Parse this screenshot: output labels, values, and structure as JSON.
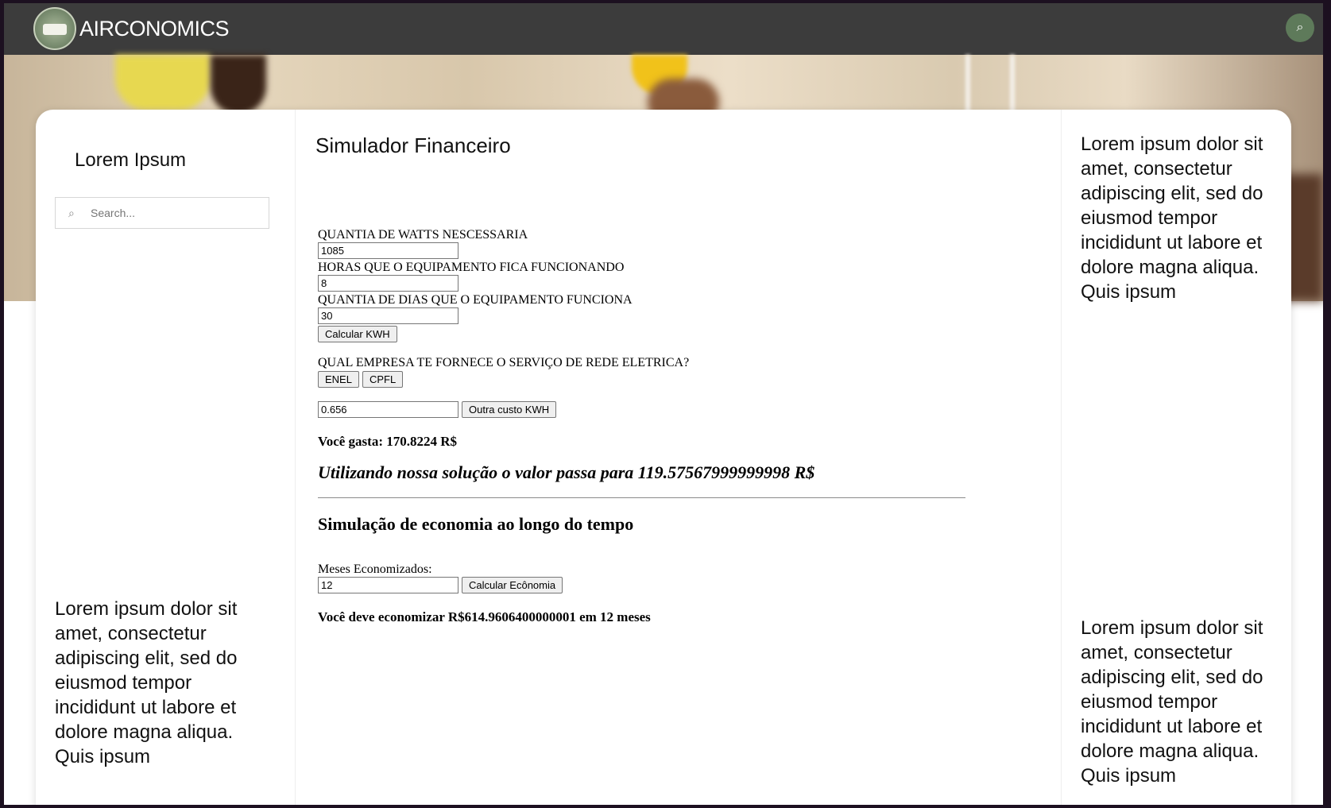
{
  "header": {
    "brand": "AIRCONOMICS",
    "search_icon_glyph": "⌕"
  },
  "left": {
    "title": "Lorem Ipsum",
    "search_placeholder": "Search...",
    "search_icon_glyph": "⌕",
    "lorem": "Lorem ipsum dolor sit amet, consectetur adipiscing elit, sed do eiusmod tempor incididunt ut labore et dolore magna aliqua. Quis ipsum"
  },
  "right": {
    "lorem_top": "Lorem ipsum dolor sit amet, consectetur adipiscing elit, sed do eiusmod tempor incididunt ut labore et dolore magna aliqua. Quis ipsum",
    "lorem_bottom": "Lorem ipsum dolor sit amet, consectetur adipiscing elit, sed do eiusmod tempor incididunt ut labore et dolore magna aliqua. Quis ipsum"
  },
  "main": {
    "title": "Simulador Financeiro",
    "watts_label": "QUANTIA DE WATTS NESCESSARIA",
    "watts_value": "1085",
    "hours_label": "HORAS QUE O EQUIPAMENTO FICA FUNCIONANDO",
    "hours_value": "8",
    "days_label": "QUANTIA DE DIAS QUE O EQUIPAMENTO FUNCIONA",
    "days_value": "30",
    "calc_kwh_label": "Calcular KWH",
    "company_question": "QUAL EMPRESA TE FORNECE O SERVIÇO DE REDE ELETRICA?",
    "enel_label": "ENEL",
    "cpfl_label": "CPFL",
    "kwh_cost_value": "0.656",
    "other_cost_label": "Outra custo KWH",
    "spend_text": "Você gasta: 170.8224 R$",
    "solution_text": "Utilizando nossa solução o valor passa para 119.57567999999998 R$",
    "savings_title": "Simulação de economia ao longo do tempo",
    "months_label": "Meses Economizados:",
    "months_value": "12",
    "calc_savings_label": "Calcular Ecônomia",
    "savings_result": "Você deve economizar R$614.9606400000001 em 12 meses"
  },
  "colors": {
    "topbar": "#3c3c3c",
    "search_button": "#5e7a5a",
    "page_bg": "#ffffff"
  }
}
